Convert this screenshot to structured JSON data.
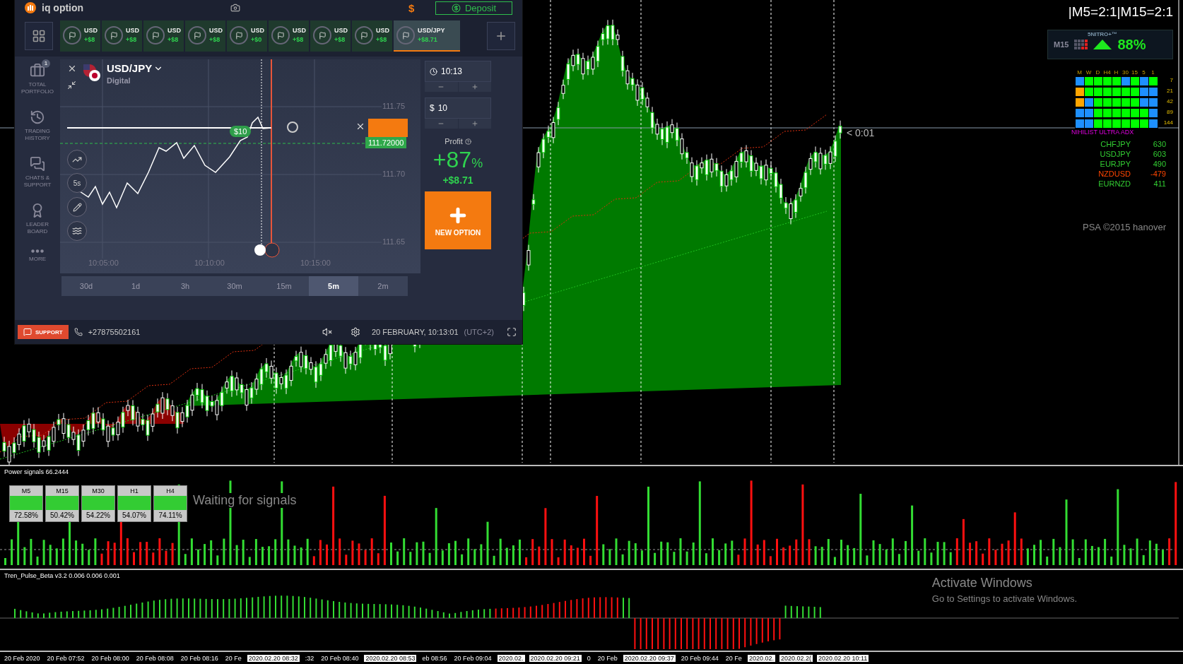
{
  "iq_panel": {
    "logo": "iq option",
    "balance": "$",
    "deposit": "Deposit",
    "asset_tabs": [
      {
        "label": "USD",
        "profit": "+$8",
        "selected": false
      },
      {
        "label": "USD",
        "profit": "+$8",
        "selected": false
      },
      {
        "label": "USD",
        "profit": "+$8",
        "selected": false
      },
      {
        "label": "USD",
        "profit": "+$8",
        "selected": false
      },
      {
        "label": "USD",
        "profit": "+$0",
        "selected": false
      },
      {
        "label": "USD",
        "profit": "+$8",
        "selected": false
      },
      {
        "label": "USD",
        "profit": "+$8",
        "selected": false
      },
      {
        "label": "USD",
        "profit": "+$8",
        "selected": false
      },
      {
        "label": "USD/JPY",
        "profit": "+$8.71",
        "selected": true
      }
    ],
    "sidebar": [
      {
        "kind": "portfolio",
        "label": "TOTAL PORTFOLIO",
        "badge": "1"
      },
      {
        "kind": "history",
        "label": "TRADING HISTORY"
      },
      {
        "kind": "chat",
        "label": "CHATS & SUPPORT"
      },
      {
        "kind": "leader",
        "label": "LEADER BOARD"
      },
      {
        "kind": "more",
        "label": "MORE"
      }
    ],
    "asset": {
      "name": "USD/JPY",
      "type": "Digital"
    },
    "chart": {
      "price_labels": [
        "111.75",
        "111.70",
        "111.65"
      ],
      "time_labels": [
        "10:05:00",
        "10:10:00",
        "10:15:00"
      ],
      "bet": "$10",
      "current_price": "111.72000",
      "tool_label": "5s"
    },
    "timeframes": [
      {
        "label": "30d",
        "selected": false
      },
      {
        "label": "1d",
        "selected": false
      },
      {
        "label": "3h",
        "selected": false
      },
      {
        "label": "30m",
        "selected": false
      },
      {
        "label": "15m",
        "selected": false
      },
      {
        "label": "5m",
        "selected": true
      },
      {
        "label": "2m",
        "selected": false
      }
    ],
    "expiry": "10:13",
    "amount_currency": "$",
    "amount": "10",
    "profit_label": "Profit",
    "profit_percent": "+87",
    "percent_sign": "%",
    "profit_amount": "+$8.71",
    "new_option": "NEW OPTION",
    "footer": {
      "support": "SUPPORT",
      "phone": "+27875502161",
      "datetime": "20 FEBRUARY, 10:13:01",
      "timezone": "(UTC+2)"
    }
  },
  "mt4": {
    "ratio": "|M5=2:1|M15=2:1",
    "nitro": {
      "timeframe": "M15",
      "brand": "5NITRO+™",
      "percent": "88%"
    },
    "adx": {
      "columns": [
        "M",
        "W",
        "D",
        "H4",
        "H",
        "30",
        "15",
        "5",
        "1"
      ],
      "rows": [
        {
          "period": "7",
          "cells": [
            {
              "color": "#1e90ff"
            },
            {
              "color": "#00ff00"
            },
            {
              "color": "#00ff00"
            },
            {
              "color": "#00ff00"
            },
            {
              "color": "#00ff00"
            },
            {
              "color": "#1e90ff"
            },
            {
              "color": "#00ff00"
            },
            {
              "color": "#1e90ff"
            },
            {
              "color": "#00ff00"
            }
          ]
        },
        {
          "period": "21",
          "cells": [
            {
              "color": "#ffa500"
            },
            {
              "color": "#00ff00"
            },
            {
              "color": "#00ff00"
            },
            {
              "color": "#00ff00"
            },
            {
              "color": "#00ff00"
            },
            {
              "color": "#00ff00"
            },
            {
              "color": "#00ff00"
            },
            {
              "color": "#1e90ff"
            },
            {
              "color": "#1e90ff"
            }
          ]
        },
        {
          "period": "42",
          "cells": [
            {
              "color": "#ffa500"
            },
            {
              "color": "#1e90ff"
            },
            {
              "color": "#00ff00"
            },
            {
              "color": "#00ff00"
            },
            {
              "color": "#00ff00"
            },
            {
              "color": "#00ff00"
            },
            {
              "color": "#00ff00"
            },
            {
              "color": "#1e90ff"
            },
            {
              "color": "#1e90ff"
            }
          ]
        },
        {
          "period": "89",
          "cells": [
            {
              "color": "#1e90ff"
            },
            {
              "color": "#1e90ff"
            },
            {
              "color": "#00ff00"
            },
            {
              "color": "#00ff00"
            },
            {
              "color": "#00ff00"
            },
            {
              "color": "#00ff00"
            },
            {
              "color": "#00ff00"
            },
            {
              "color": "#00ff00"
            },
            {
              "color": "#1e90ff"
            }
          ]
        },
        {
          "period": "144",
          "cells": [
            {
              "color": "#1e90ff"
            },
            {
              "color": "#1e90ff"
            },
            {
              "color": "#00ff00"
            },
            {
              "color": "#00ff00"
            },
            {
              "color": "#00ff00"
            },
            {
              "color": "#00ff00"
            },
            {
              "color": "#00ff00"
            },
            {
              "color": "#00ff00"
            },
            {
              "color": "#1e90ff"
            }
          ]
        }
      ],
      "title": "NIHILIST ULTRA ADX"
    },
    "pairs": [
      {
        "name": "CHFJPY",
        "value": "630",
        "color": "#32cd32"
      },
      {
        "name": "USDJPY",
        "value": "603",
        "color": "#32cd32"
      },
      {
        "name": "EURJPY",
        "value": "490",
        "color": "#32cd32"
      },
      {
        "name": "NZDUSD",
        "value": "-479",
        "color": "#ff4500"
      },
      {
        "name": "EURNZD",
        "value": "411",
        "color": "#32cd32"
      }
    ],
    "copyright": "PSA ©2015 hanover",
    "countdown": "< 0:01"
  },
  "power_signals": {
    "title": "Power signals 66.2444",
    "message": "Waiting for signals",
    "boxes": [
      {
        "timeframe": "M5",
        "percent": "72.58%"
      },
      {
        "timeframe": "M15",
        "percent": "50.42%"
      },
      {
        "timeframe": "M30",
        "percent": "54.22%"
      },
      {
        "timeframe": "H1",
        "percent": "54.07%"
      },
      {
        "timeframe": "H4",
        "percent": "74.11%"
      }
    ]
  },
  "pulse": {
    "title": "Tren_Pulse_Beta v3.2 0.006 0.006 0.001"
  },
  "time_axis": [
    {
      "label": "20 Feb 2020",
      "highlighted": false
    },
    {
      "label": "20 Feb 07:52",
      "highlighted": false
    },
    {
      "label": "20 Feb 08:00",
      "highlighted": false
    },
    {
      "label": "20 Feb 08:08",
      "highlighted": false
    },
    {
      "label": "20 Feb 08:16",
      "highlighted": false
    },
    {
      "label": "20 Fe",
      "highlighted": false
    },
    {
      "label": "2020.02.20 08:32",
      "highlighted": true
    },
    {
      "label": ":32",
      "highlighted": false
    },
    {
      "label": "20 Feb 08:40",
      "highlighted": false
    },
    {
      "label": "2020.02.20 08:53",
      "highlighted": true
    },
    {
      "label": "eb 08:56",
      "highlighted": false
    },
    {
      "label": "20 Feb 09:04",
      "highlighted": false
    },
    {
      "label": "2020.02.",
      "highlighted": true
    },
    {
      "label": "2020.02.20 09:21",
      "highlighted": true
    },
    {
      "label": "0",
      "highlighted": false
    },
    {
      "label": "20 Feb",
      "highlighted": false
    },
    {
      "label": "2020.02.20 09:37",
      "highlighted": true
    },
    {
      "label": "20 Feb 09:44",
      "highlighted": false
    },
    {
      "label": "20 Fe",
      "highlighted": false
    },
    {
      "label": "2020.02.",
      "highlighted": true
    },
    {
      "label": "2020.02.2(",
      "highlighted": true
    },
    {
      "label": "2020.02.20 10:11",
      "highlighted": true
    }
  ],
  "os_notice": {
    "title": "Activate Windows",
    "message": "Go to Settings to activate Windows."
  }
}
